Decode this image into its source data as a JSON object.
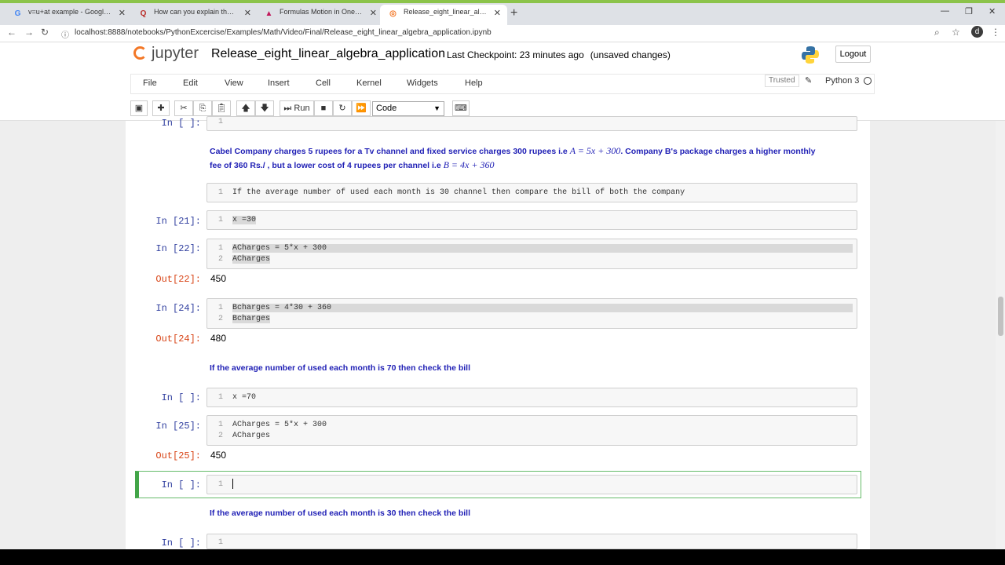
{
  "browser": {
    "tabs": [
      {
        "label": "v=u+at example - Google Search",
        "fav": "G",
        "fav_color": "#4285f4"
      },
      {
        "label": "How can you explain the equation",
        "fav": "Q",
        "fav_color": "#b92b27"
      },
      {
        "label": "Formulas Motion in One Dimensi",
        "fav": "▲",
        "fav_color": "#c2185b"
      },
      {
        "label": "Release_eight_linear_algebra_ap",
        "fav": "◎",
        "fav_color": "#f37726"
      }
    ],
    "url": "localhost:8888/notebooks/PythonExcercise/Examples/Math/Video/Final/Release_eight_linear_algebra_application.ipynb",
    "avatar": "d"
  },
  "jupyter": {
    "logo": "jupyter",
    "title": "Release_eight_linear_algebra_application",
    "checkpoint": "Last Checkpoint: 23 minutes ago",
    "unsaved": "(unsaved changes)",
    "logout": "Logout",
    "menu": [
      "File",
      "Edit",
      "View",
      "Insert",
      "Cell",
      "Kernel",
      "Widgets",
      "Help"
    ],
    "trusted": "Trusted",
    "kernel": "Python 3",
    "run_label": "Run",
    "cell_type": "Code"
  },
  "cells": {
    "c0_prompt": "In [ ]:",
    "md1_a": "Cabel Company charges 5 rupees for a Tv channel and fixed service charges 300 rupees i.e",
    "md1_math1": "A = 5x + 300",
    "md1_b": ". Company B's package charges a higher monthly",
    "md1_c": "fee of 360 Rs./ , but a lower cost of 4 rupees per channel i.e",
    "md1_math2": "B = 4x + 360",
    "raw1": "If the average number of used each month is 30 channel then compare the bill of both the company",
    "c21_prompt": "In [21]:",
    "c21_code": "x =30",
    "c22_prompt": "In [22]:",
    "c22_line1": "ACharges = 5*x + 300",
    "c22_line2": "ACharges",
    "o22_prompt": "Out[22]:",
    "o22_val": "450",
    "c24_prompt": "In [24]:",
    "c24_line1": "Bcharges = 4*30 + 360",
    "c24_line2": "Bcharges",
    "o24_prompt": "Out[24]:",
    "o24_val": "480",
    "md2": "If the average number of used each month is 70 then check the bill",
    "c70_prompt": "In [ ]:",
    "c70_code": "x =70",
    "c25_prompt": "In [25]:",
    "c25_line1": "ACharges = 5*x + 300",
    "c25_line2": "ACharges",
    "o25_prompt": "Out[25]:",
    "o25_val": "450",
    "csel_prompt": "In [ ]:",
    "md3": "If the average number of used each month is 30 then check the bill",
    "clast_prompt": "In [ ]:"
  },
  "line_numbers": {
    "one": "1",
    "two": "2"
  }
}
